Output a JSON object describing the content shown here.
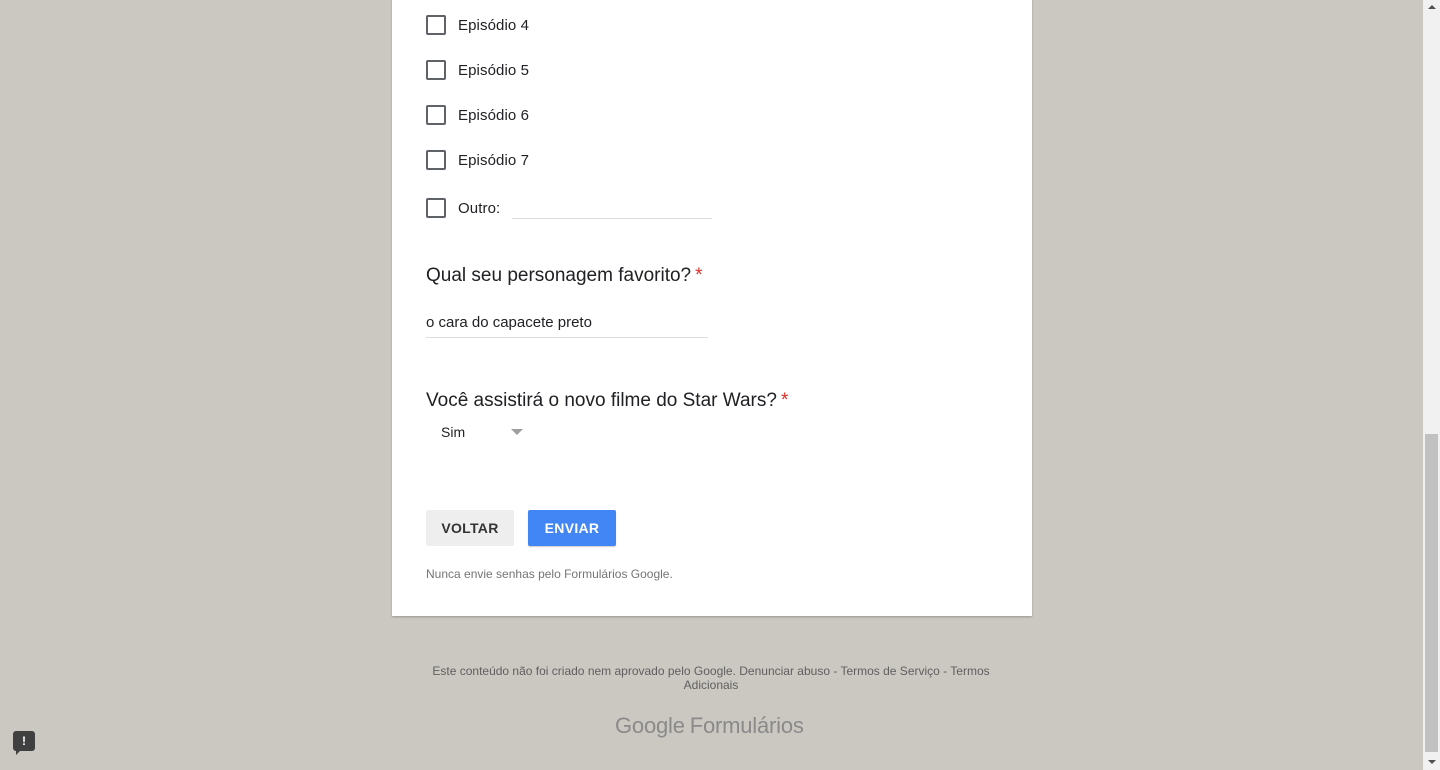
{
  "form": {
    "episodes": [
      {
        "label": "Episódio 4"
      },
      {
        "label": "Episódio 5"
      },
      {
        "label": "Episódio 6"
      },
      {
        "label": "Episódio 7"
      }
    ],
    "other_label": "Outro:",
    "question_character": {
      "title": "Qual seu personagem favorito?",
      "required_mark": "*",
      "answer": "o cara do capacete preto"
    },
    "question_movie": {
      "title": "Você assistirá o novo filme do Star Wars?",
      "required_mark": "*",
      "selected": "Sim"
    },
    "buttons": {
      "back": "VOLTAR",
      "submit": "ENVIAR"
    },
    "password_note": "Nunca envie senhas pelo Formulários Google."
  },
  "footer": {
    "disclaimer": "Este conteúdo não foi criado nem aprovado pelo Google.",
    "report_abuse": "Denunciar abuso",
    "separator": " - ",
    "terms_service": "Termos de Serviço",
    "terms_additional": "Termos Adicionais",
    "brand_google": "Google",
    "brand_product": "Formulários"
  },
  "icons": {
    "report": "report-issue-icon",
    "dropdown": "dropdown-arrow-icon"
  },
  "colors": {
    "background": "#cbc8c1",
    "accent": "#4285f4",
    "required": "#d93025"
  }
}
